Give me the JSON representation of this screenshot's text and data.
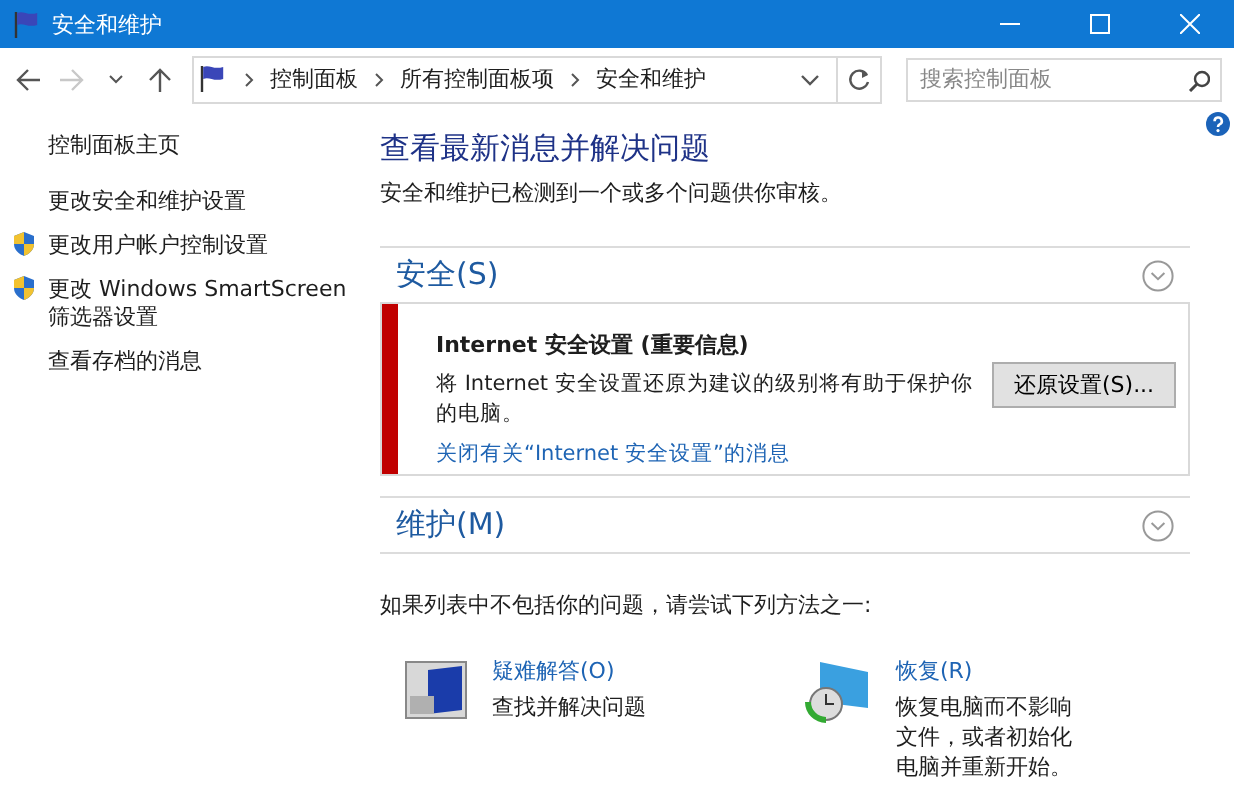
{
  "window": {
    "title": "安全和维护"
  },
  "address_bar": {
    "breadcrumbs": [
      "控制面板",
      "所有控制面板项",
      "安全和维护"
    ]
  },
  "search": {
    "placeholder": "搜索控制面板"
  },
  "sidebar": {
    "items": [
      {
        "label": "控制面板主页",
        "kind": "link"
      },
      {
        "label": "更改安全和维护设置",
        "kind": "link"
      },
      {
        "label": "更改用户帐户控制设置",
        "kind": "shield"
      },
      {
        "label": "更改 Windows SmartScreen 筛选器设置",
        "kind": "shield"
      },
      {
        "label": "查看存档的消息",
        "kind": "link"
      }
    ]
  },
  "main": {
    "heading": "查看最新消息并解决问题",
    "subtitle": "安全和维护已检测到一个或多个问题供你审核。",
    "sections": [
      {
        "title": "安全(S)",
        "alerts": [
          {
            "title": "Internet 安全设置 (重要信息)",
            "message": "将 Internet 安全设置还原为建议的级别将有助于保护你的电脑。",
            "link": "关闭有关“Internet 安全设置”的消息",
            "button": "还原设置(S)..."
          }
        ]
      },
      {
        "title": "维护(M)"
      }
    ],
    "hint": "如果列表中不包括你的问题，请尝试下列方法之一:",
    "options": [
      {
        "title": "疑难解答(O)",
        "description": "查找并解决问题",
        "kind": "troubleshoot"
      },
      {
        "title": "恢复(R)",
        "description": "恢复电脑而不影响文件，或者初始化电脑并重新开始。",
        "kind": "recovery"
      }
    ]
  }
}
